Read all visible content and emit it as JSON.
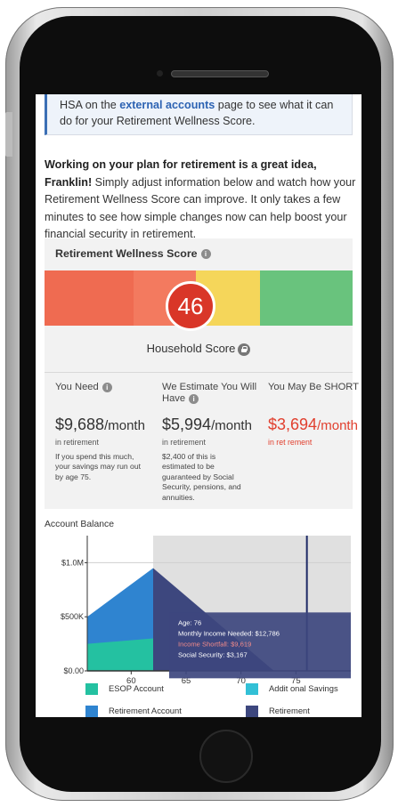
{
  "notice": {
    "text_before": "HSA on the ",
    "link": "external accounts",
    "text_after": " page to see what it can do for your Retirement Wellness Score."
  },
  "intro": {
    "bold": "Working on your plan for retirement is a great idea, Franklin!",
    "body": " Simply adjust information below and watch how your Retirement Wellness Score can improve. It only takes a few minutes to see how simple changes now can help boost your financial security in retirement."
  },
  "score": {
    "title": "Retirement Wellness Score",
    "value": "46",
    "household_label": "Household Score",
    "bar_colors": [
      "#ef6b51",
      "#f37a5f",
      "#f5d65a",
      "#69c37d"
    ]
  },
  "metrics": {
    "need": {
      "label": "You Need",
      "amount": "$9,688",
      "unit": "/month",
      "sub": "in retirement",
      "note": "If you spend this much, your savings may run out by age 75."
    },
    "have": {
      "label": "We Estimate You Will Have",
      "amount": "$5,994",
      "unit": "/month",
      "sub": "in retirement",
      "note": "$2,400 of this is estimated to be guaranteed by Social Security, pensions, and annuities."
    },
    "short": {
      "label": "You May Be SHORT",
      "amount": "$3,694",
      "unit": "/month",
      "sub": "in ret rement"
    }
  },
  "chart": {
    "title": "Account Balance",
    "tooltip": {
      "age": "Age: 76",
      "needed": "Monthly Income Needed: $12,786",
      "shortfall": "Income Shortfall: $9,619",
      "ss": "Social Security: $3,167"
    },
    "legend": [
      {
        "label": "ESOP Account",
        "color": "#24c1a1"
      },
      {
        "label": "Addit onal Savings",
        "color": "#32c0d6"
      },
      {
        "label": "Retirement Account",
        "color": "#2f84d0"
      },
      {
        "label": "Retirement",
        "color": "#3d477e"
      }
    ]
  },
  "chart_data": {
    "type": "area",
    "title": "Account Balance",
    "x_ticks": [
      60,
      65,
      70,
      75
    ],
    "y_ticks": [
      "$0.00",
      "$500K",
      "$1.0M"
    ],
    "xlim": [
      56,
      80
    ],
    "ylim": [
      0,
      1250000
    ],
    "series": [
      {
        "name": "ESOP Account",
        "x": [
          56,
          62
        ],
        "values": [
          250000,
          300000
        ]
      },
      {
        "name": "Retirement Account",
        "x": [
          56,
          62
        ],
        "values": [
          500000,
          950000
        ]
      },
      {
        "name": "Retirement",
        "x": [
          62,
          73
        ],
        "values": [
          950000,
          0
        ]
      }
    ],
    "highlight_age": 76
  }
}
